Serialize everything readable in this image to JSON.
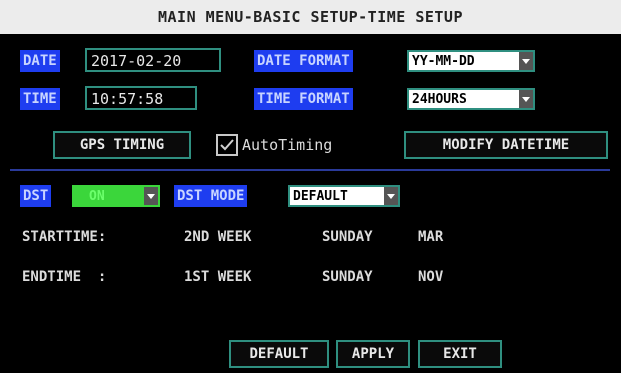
{
  "title": "MAIN MENU-BASIC SETUP-TIME SETUP",
  "date": {
    "label": "DATE",
    "value": "2017-02-20"
  },
  "date_format": {
    "label": "DATE FORMAT",
    "value": "YY-MM-DD"
  },
  "time": {
    "label": "TIME",
    "value": "10:57:58"
  },
  "time_format": {
    "label": "TIME FORMAT",
    "value": "24HOURS"
  },
  "gps_timing_label": "GPS TIMING",
  "autotiming": {
    "label": "AutoTiming",
    "checked": true
  },
  "modify_datetime_label": "MODIFY DATETIME",
  "dst": {
    "label": "DST",
    "value": "ON",
    "value_color": "#3bd63b"
  },
  "dst_mode": {
    "label": "DST MODE",
    "value": "DEFAULT"
  },
  "starttime": {
    "label": "STARTTIME:",
    "week": "2ND WEEK",
    "day": "SUNDAY",
    "month": "MAR"
  },
  "endtime": {
    "label": "ENDTIME  :",
    "week": "1ST WEEK",
    "day": "SUNDAY",
    "month": "NOV"
  },
  "buttons": {
    "default": "DEFAULT",
    "apply": "APPLY",
    "exit": "EXIT"
  }
}
